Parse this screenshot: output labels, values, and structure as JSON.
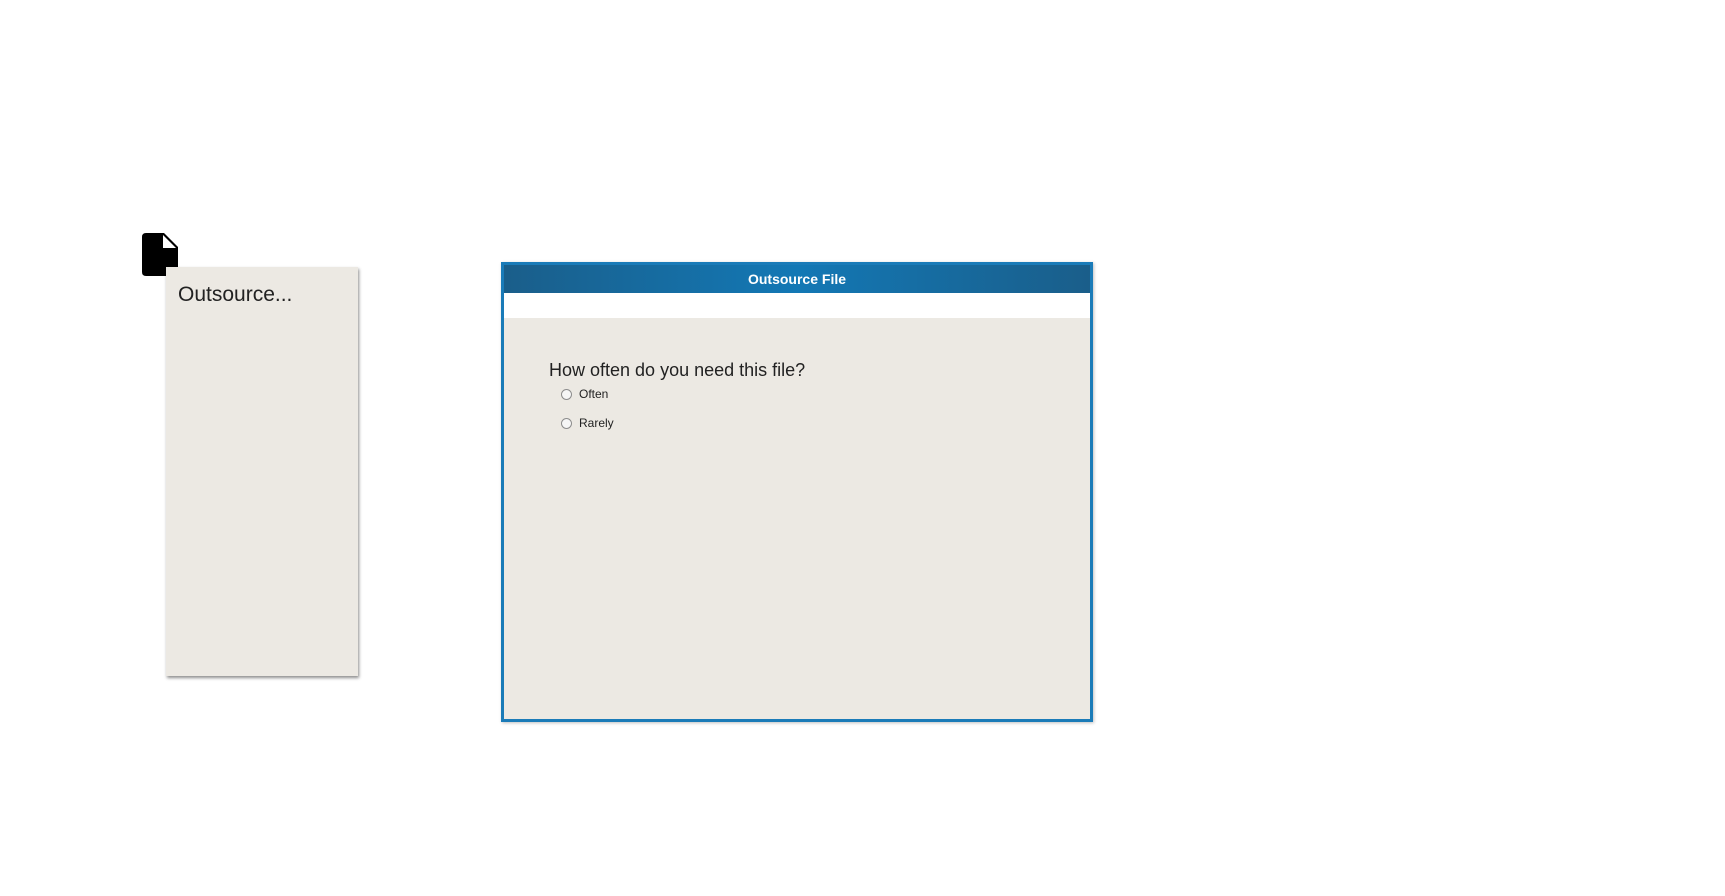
{
  "desktop": {
    "file_icon": "file-icon",
    "panel": {
      "title": "Outsource..."
    }
  },
  "dialog": {
    "title": "Outsource File",
    "question": "How often do you need this file?",
    "options": [
      {
        "label": "Often",
        "selected": false
      },
      {
        "label": "Rarely",
        "selected": false
      }
    ],
    "colors": {
      "titlebar": "#1378b5",
      "border": "#1a7bb8",
      "body": "#ece9e3"
    }
  }
}
